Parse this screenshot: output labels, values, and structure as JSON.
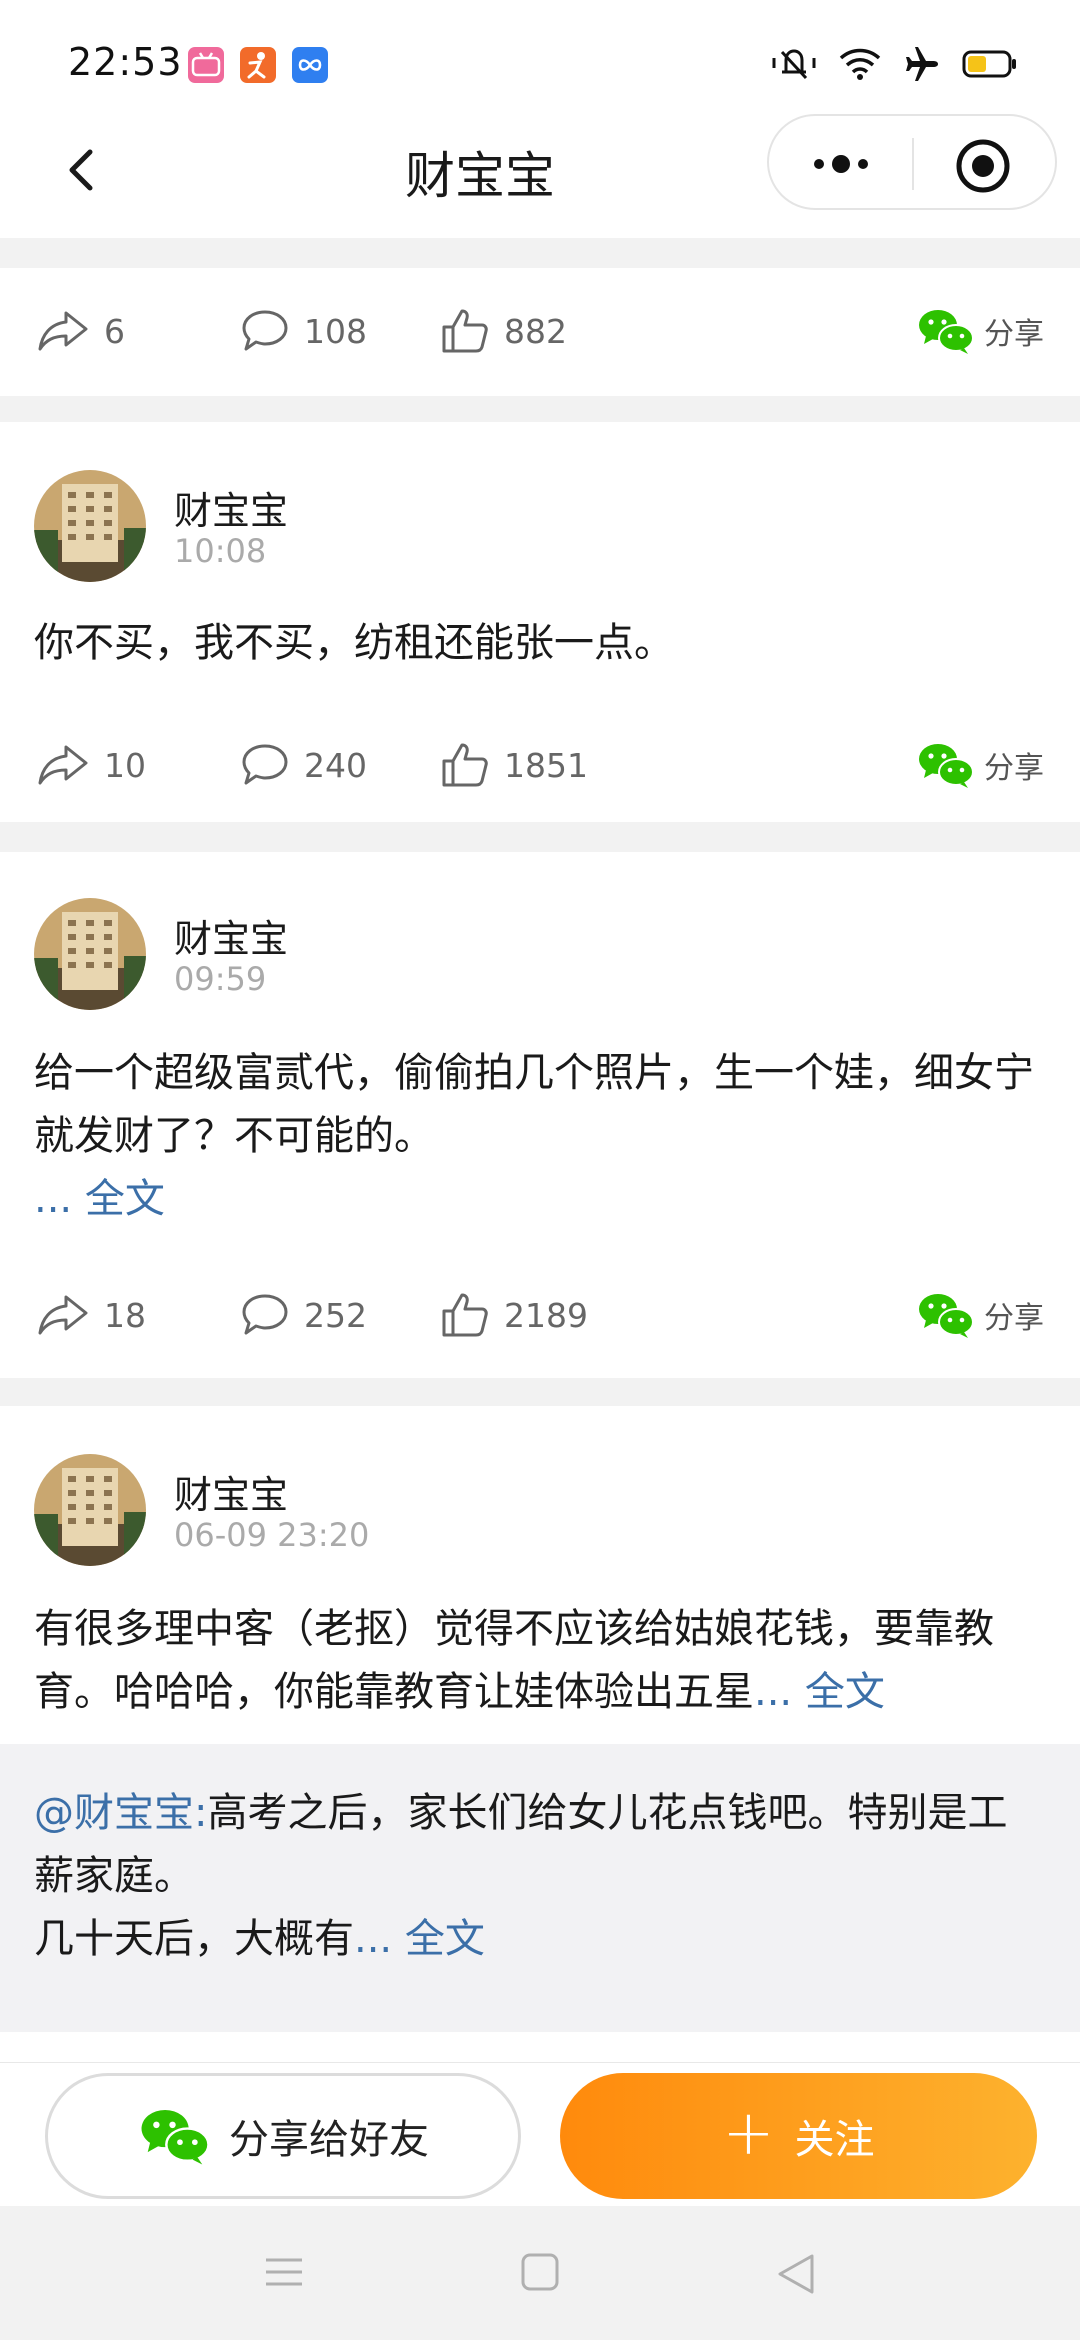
{
  "status_bar": {
    "time": "22:53",
    "app_icons": [
      "bilibili-icon",
      "fitness-app-icon",
      "infinity-app-icon"
    ],
    "indicators": [
      "mute-icon",
      "wifi-icon",
      "airplane-mode-icon",
      "battery-icon"
    ]
  },
  "nav": {
    "title": "财宝宝",
    "back_icon": "chevron-left-icon",
    "more_icon": "more-dots-icon",
    "close_icon": "target-circle-icon"
  },
  "posts": [
    {
      "reposts": "6",
      "comments": "108",
      "likes": "882",
      "share_label": "分享"
    },
    {
      "author": "财宝宝",
      "time": "10:08",
      "text": "你不买，我不买，纺租还能张一点。",
      "reposts": "10",
      "comments": "240",
      "likes": "1851",
      "share_label": "分享"
    },
    {
      "author": "财宝宝",
      "time": "09:59",
      "text": "给一个超级富贰代，偷偷拍几个照片，生一个娃，细女宁就发财了？不可能的。",
      "more": "... 全文",
      "reposts": "18",
      "comments": "252",
      "likes": "2189",
      "share_label": "分享"
    },
    {
      "author": "财宝宝",
      "time": "06-09 23:20",
      "text": "有很多理中客（老抠）觉得不应该给姑娘花钱，要靠教育。哈哈哈，你能靠教育让娃体验出五星",
      "more": "... 全文",
      "quote": {
        "mention": "@财宝宝:",
        "text_line1": "高考之后，家长们给女儿花点钱吧。特别是工薪家庭。",
        "text_line2": "几十天后，大概有",
        "more": "... 全文"
      }
    }
  ],
  "bottom": {
    "share_friends": "分享给好友",
    "follow": "关注",
    "follow_plus": "+"
  },
  "colors": {
    "accent_orange_start": "#ff8a0c",
    "accent_orange_end": "#fdb22e",
    "link_blue": "#3b6fa8",
    "wechat_green": "#2dc100"
  }
}
